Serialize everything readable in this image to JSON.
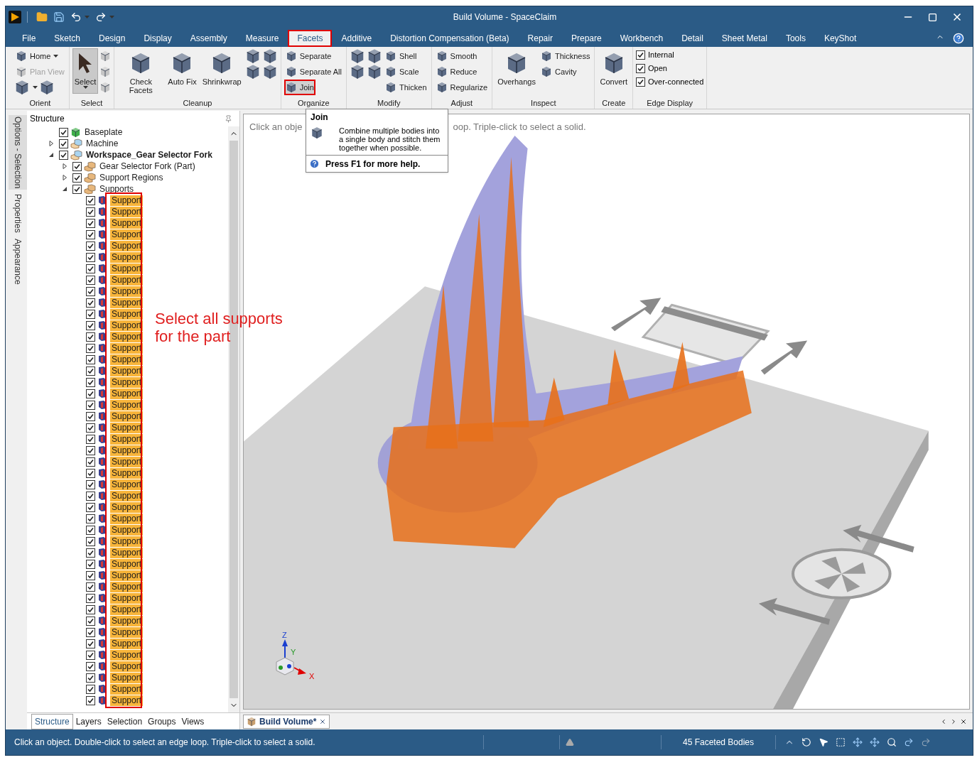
{
  "title_bar": {
    "title": "Build Volume - SpaceClaim"
  },
  "menu": [
    {
      "label": "File",
      "selected": false,
      "highlighted": false
    },
    {
      "label": "Sketch",
      "selected": false,
      "highlighted": false
    },
    {
      "label": "Design",
      "selected": false,
      "highlighted": false
    },
    {
      "label": "Display",
      "selected": false,
      "highlighted": false
    },
    {
      "label": "Assembly",
      "selected": false,
      "highlighted": false
    },
    {
      "label": "Measure",
      "selected": false,
      "highlighted": false
    },
    {
      "label": "Facets",
      "selected": true,
      "highlighted": true
    },
    {
      "label": "Additive",
      "selected": false,
      "highlighted": false
    },
    {
      "label": "Distortion Compensation (Beta)",
      "selected": false,
      "highlighted": false
    },
    {
      "label": "Repair",
      "selected": false,
      "highlighted": false
    },
    {
      "label": "Prepare",
      "selected": false,
      "highlighted": false
    },
    {
      "label": "Workbench",
      "selected": false,
      "highlighted": false
    },
    {
      "label": "Detail",
      "selected": false,
      "highlighted": false
    },
    {
      "label": "Sheet Metal",
      "selected": false,
      "highlighted": false
    },
    {
      "label": "Tools",
      "selected": false,
      "highlighted": false
    },
    {
      "label": "KeyShot",
      "selected": false,
      "highlighted": false
    }
  ],
  "ribbon": [
    {
      "title": "Orient",
      "columns": [
        [
          [
            {
              "kind": "small",
              "label": "Home",
              "dropdown": true,
              "disabled": false
            }
          ],
          [
            {
              "kind": "small",
              "label": "Plan View",
              "dropdown": false,
              "disabled": true
            }
          ],
          [
            {
              "kind": "icon",
              "dropdown": true,
              "disabled": false
            },
            {
              "kind": "icon",
              "dropdown": false,
              "disabled": false
            }
          ]
        ]
      ]
    },
    {
      "title": "Select",
      "columns": [
        [
          [
            {
              "kind": "large",
              "label": "Select",
              "dropdown": true,
              "selected": true
            }
          ]
        ],
        [
          [
            {
              "kind": "icon",
              "disabled": true
            }
          ],
          [
            {
              "kind": "icon",
              "disabled": true
            }
          ],
          [
            {
              "kind": "icon",
              "disabled": true
            }
          ]
        ]
      ]
    },
    {
      "title": "Cleanup",
      "columns": [
        [
          [
            {
              "kind": "large",
              "label": "Check Facets"
            }
          ]
        ],
        [
          [
            {
              "kind": "large",
              "label": "Auto Fix"
            }
          ]
        ],
        [
          [
            {
              "kind": "large",
              "label": "Shrinkwrap"
            }
          ]
        ],
        [
          [
            {
              "kind": "icon"
            }
          ],
          [
            {
              "kind": "icon"
            }
          ]
        ],
        [
          [
            {
              "kind": "icon"
            }
          ],
          [
            {
              "kind": "icon"
            }
          ]
        ]
      ]
    },
    {
      "title": "Organize",
      "columns": [
        [
          [
            {
              "kind": "small",
              "label": "Separate",
              "highlighted": false
            }
          ],
          [
            {
              "kind": "small",
              "label": "Separate All",
              "highlighted": false
            }
          ],
          [
            {
              "kind": "small",
              "label": "Join",
              "highlighted": true
            }
          ]
        ]
      ]
    },
    {
      "title": "Modify",
      "columns": [
        [
          [
            {
              "kind": "icon"
            }
          ],
          [
            {
              "kind": "icon"
            }
          ]
        ],
        [
          [
            {
              "kind": "icon"
            }
          ],
          [
            {
              "kind": "icon"
            }
          ]
        ],
        [
          [
            {
              "kind": "small",
              "label": "Shell"
            }
          ],
          [
            {
              "kind": "small",
              "label": "Scale"
            }
          ],
          [
            {
              "kind": "small",
              "label": "Thicken"
            }
          ]
        ]
      ]
    },
    {
      "title": "Adjust",
      "columns": [
        [
          [
            {
              "kind": "small",
              "label": "Smooth"
            }
          ],
          [
            {
              "kind": "small",
              "label": "Reduce"
            }
          ],
          [
            {
              "kind": "small",
              "label": "Regularize"
            }
          ]
        ]
      ]
    },
    {
      "title": "Inspect",
      "columns": [
        [
          [
            {
              "kind": "large",
              "label": "Overhangs"
            }
          ]
        ],
        [
          [
            {
              "kind": "small",
              "label": "Thickness"
            }
          ],
          [
            {
              "kind": "small",
              "label": "Cavity"
            }
          ]
        ]
      ]
    },
    {
      "title": "Create",
      "columns": [
        [
          [
            {
              "kind": "large",
              "label": "Convert"
            }
          ]
        ]
      ]
    },
    {
      "title": "Edge Display",
      "columns": [
        [
          [
            {
              "kind": "check",
              "label": "Internal",
              "checked": true
            }
          ],
          [
            {
              "kind": "check",
              "label": "Open",
              "checked": true
            }
          ],
          [
            {
              "kind": "check",
              "label": "Over-connected",
              "checked": true
            }
          ]
        ]
      ]
    }
  ],
  "side_tabs": [
    {
      "label": "Options - Selection",
      "selected": true
    },
    {
      "label": "Properties",
      "selected": false
    },
    {
      "label": "Appearance",
      "selected": false
    }
  ],
  "structure": {
    "title": "Structure",
    "tree": [
      {
        "label": "Baseplate",
        "checked": true,
        "selected": false,
        "active": false
      },
      {
        "label": "Machine",
        "checked": true,
        "expanded": false,
        "selected": false,
        "active": false
      },
      {
        "label": "Workspace_Gear Selector Fork",
        "checked": true,
        "expanded": true,
        "selected": false,
        "active": true,
        "children": [
          {
            "label": "Gear Selector Fork (Part)",
            "checked": true,
            "expanded": false,
            "selected": false,
            "active": false
          },
          {
            "label": "Support Regions",
            "checked": true,
            "expanded": false,
            "selected": false,
            "active": false
          },
          {
            "label": "Supports",
            "checked": true,
            "expanded": true,
            "selected": false,
            "active": false,
            "children": [
              {
                "label": "Support",
                "checked": true,
                "selected": true
              },
              {
                "label": "Support",
                "checked": true,
                "selected": true
              },
              {
                "label": "Support",
                "checked": true,
                "selected": true
              },
              {
                "label": "Support",
                "checked": true,
                "selected": true
              },
              {
                "label": "Support",
                "checked": true,
                "selected": true
              },
              {
                "label": "Support",
                "checked": true,
                "selected": true
              },
              {
                "label": "Support",
                "checked": true,
                "selected": true
              },
              {
                "label": "Support",
                "checked": true,
                "selected": true
              },
              {
                "label": "Support",
                "checked": true,
                "selected": true
              },
              {
                "label": "Support",
                "checked": true,
                "selected": true
              },
              {
                "label": "Support",
                "checked": true,
                "selected": true
              },
              {
                "label": "Support",
                "checked": true,
                "selected": true
              },
              {
                "label": "Support",
                "checked": true,
                "selected": true
              },
              {
                "label": "Support",
                "checked": true,
                "selected": true
              },
              {
                "label": "Support",
                "checked": true,
                "selected": true
              },
              {
                "label": "Support",
                "checked": true,
                "selected": true
              },
              {
                "label": "Support",
                "checked": true,
                "selected": true
              },
              {
                "label": "Support",
                "checked": true,
                "selected": true
              },
              {
                "label": "Support",
                "checked": true,
                "selected": true
              },
              {
                "label": "Support",
                "checked": true,
                "selected": true
              },
              {
                "label": "Support",
                "checked": true,
                "selected": true
              },
              {
                "label": "Support",
                "checked": true,
                "selected": true
              },
              {
                "label": "Support",
                "checked": true,
                "selected": true
              },
              {
                "label": "Support",
                "checked": true,
                "selected": true
              },
              {
                "label": "Support",
                "checked": true,
                "selected": true
              },
              {
                "label": "Support",
                "checked": true,
                "selected": true
              },
              {
                "label": "Support",
                "checked": true,
                "selected": true
              },
              {
                "label": "Support",
                "checked": true,
                "selected": true
              },
              {
                "label": "Support",
                "checked": true,
                "selected": true
              },
              {
                "label": "Support",
                "checked": true,
                "selected": true
              },
              {
                "label": "Support",
                "checked": true,
                "selected": true
              },
              {
                "label": "Support",
                "checked": true,
                "selected": true
              },
              {
                "label": "Support",
                "checked": true,
                "selected": true
              },
              {
                "label": "Support",
                "checked": true,
                "selected": true
              },
              {
                "label": "Support",
                "checked": true,
                "selected": true
              },
              {
                "label": "Support",
                "checked": true,
                "selected": true
              },
              {
                "label": "Support",
                "checked": true,
                "selected": true
              },
              {
                "label": "Support",
                "checked": true,
                "selected": true
              },
              {
                "label": "Support",
                "checked": true,
                "selected": true
              },
              {
                "label": "Support",
                "checked": true,
                "selected": true
              },
              {
                "label": "Support",
                "checked": true,
                "selected": true
              },
              {
                "label": "Support",
                "checked": true,
                "selected": true
              },
              {
                "label": "Support",
                "checked": true,
                "selected": true
              },
              {
                "label": "Support",
                "checked": true,
                "selected": true
              },
              {
                "label": "Support",
                "checked": true,
                "selected": true
              }
            ]
          }
        ]
      }
    ]
  },
  "annotation": {
    "text": "Select all supports for the part",
    "frame": true
  },
  "panel_tabs": [
    {
      "label": "Structure",
      "selected": true
    },
    {
      "label": "Layers",
      "selected": false
    },
    {
      "label": "Selection",
      "selected": false
    },
    {
      "label": "Groups",
      "selected": false
    },
    {
      "label": "Views",
      "selected": false
    }
  ],
  "viewport": {
    "hint_start": "Click an obje",
    "hint_end": "oop. Triple-click to select a solid.",
    "axes": {
      "z": "Z",
      "y": "Y",
      "x": "X"
    }
  },
  "tooltip": {
    "title": "Join",
    "text": "Combine multiple bodies into a single body and stitch them together when possible.",
    "help": "Press F1 for more help."
  },
  "doc_tabs": [
    {
      "label": "Build Volume*",
      "selected": true
    }
  ],
  "status_bar": {
    "message": "Click an object. Double-click to select an edge loop. Triple-click to select a solid.",
    "count": "45 Faceted Bodies"
  }
}
